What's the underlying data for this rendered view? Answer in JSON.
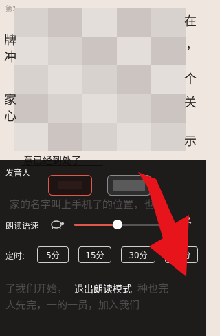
{
  "reader": {
    "chapter_label": "第1",
    "right_col": [
      "在",
      "，",
      "个",
      "关",
      "示"
    ],
    "left_col": [
      "牌",
      "冲",
      "家",
      "心"
    ],
    "underlined": "意已经到处了"
  },
  "panel": {
    "voice_label": "发音人",
    "speed_label": "朗读语速",
    "speed_value": 0.47,
    "timer_label": "定时:",
    "timer_options": [
      "5分",
      "15分",
      "30分",
      "60分"
    ],
    "exit_label": "退出朗读模式"
  },
  "icons": {
    "slow": "turtle-icon",
    "fast": "runner-icon",
    "pointer": "red-arrow-annotation"
  },
  "colors": {
    "accent": "#e0574c",
    "annotation": "#e8141c",
    "panel_bg": "#0c0a0a"
  }
}
